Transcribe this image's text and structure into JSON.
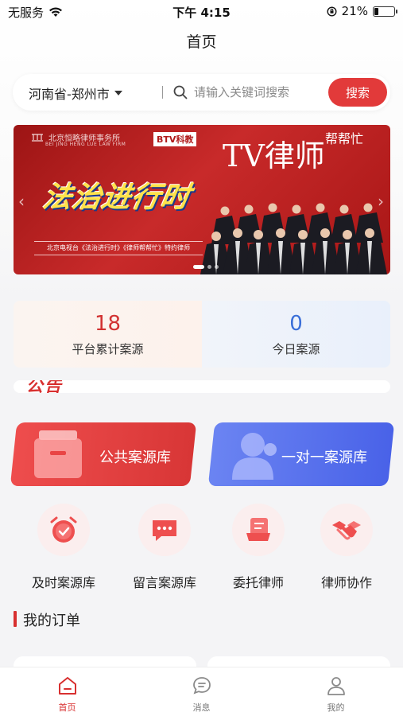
{
  "status": {
    "carrier": "无服务",
    "time": "下午 4:15",
    "battery": "21%",
    "battery_level": 0.21
  },
  "nav": {
    "title": "首页"
  },
  "search": {
    "region": "河南省-郑州市",
    "placeholder": "请输入关键词搜索",
    "button": "搜索"
  },
  "banner": {
    "firm": "北京恒略律师事务所",
    "firm_en": "BEI JING HENG LUE LAW FIRM",
    "channel": "BTV科教",
    "show": "法治进行时",
    "tv_logo": "TV律师",
    "tv_side": "帮帮忙",
    "caption": "北京电视台《法治进行时》《律师帮帮忙》特约律师"
  },
  "stats": [
    {
      "value": "18",
      "label": "平台累计案源"
    },
    {
      "value": "0",
      "label": "今日案源"
    }
  ],
  "notice": {
    "title": "公告"
  },
  "big_cards": [
    {
      "label": "公共案源库"
    },
    {
      "label": "一对一案源库"
    }
  ],
  "functions": [
    {
      "label": "及时案源库",
      "icon": "alarm-clock-icon"
    },
    {
      "label": "留言案源库",
      "icon": "message-icon"
    },
    {
      "label": "委托律师",
      "icon": "document-icon"
    },
    {
      "label": "律师协作",
      "icon": "handshake-icon"
    }
  ],
  "orders": {
    "title": "我的订单"
  },
  "tabs": [
    {
      "label": "首页",
      "icon": "home-icon",
      "active": true
    },
    {
      "label": "消息",
      "icon": "chat-icon",
      "active": false
    },
    {
      "label": "我的",
      "icon": "user-icon",
      "active": false
    }
  ],
  "colors": {
    "accent": "#e23a3a",
    "blue": "#4962e8"
  }
}
